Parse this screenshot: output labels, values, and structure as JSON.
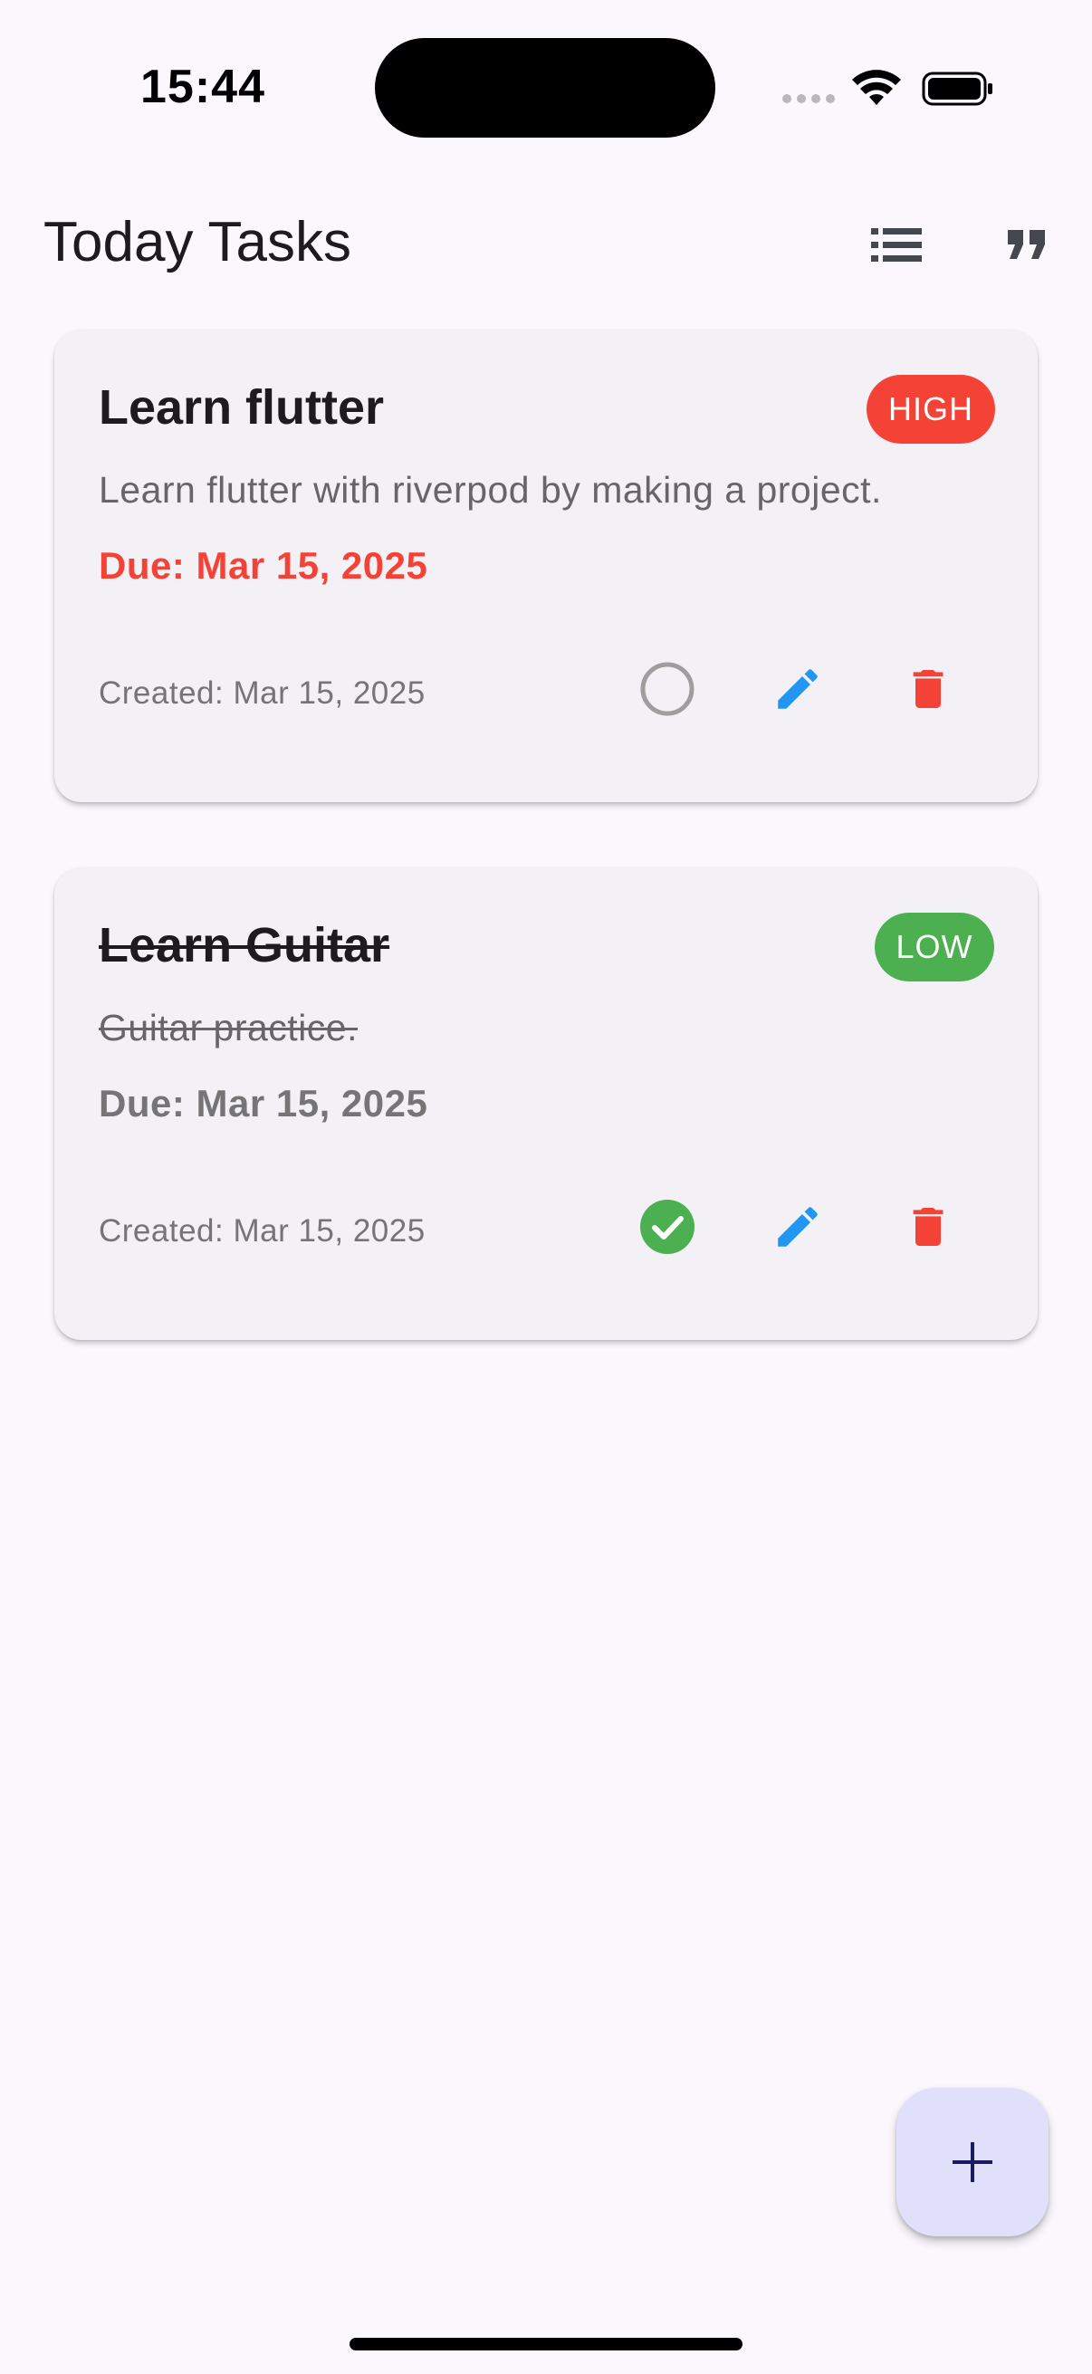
{
  "status_bar": {
    "time": "15:44"
  },
  "app_bar": {
    "title": "Today Tasks",
    "actions": [
      "list-icon",
      "format-quote-icon"
    ]
  },
  "tasks": [
    {
      "title": "Learn flutter",
      "priority": "HIGH",
      "priority_color": "#f44336",
      "description": "Learn flutter with riverpod by making a project.",
      "due": "Due: Mar 15, 2025",
      "created": "Created: Mar 15, 2025",
      "completed": false
    },
    {
      "title": "Learn Guitar",
      "priority": "LOW",
      "priority_color": "#4caf50",
      "description": "Guitar practice.",
      "due": "Due: Mar 15, 2025",
      "created": "Created: Mar 15, 2025",
      "completed": true
    }
  ],
  "colors": {
    "accent_edit": "#2196f3",
    "delete": "#f44336",
    "completed": "#4caf50",
    "fab_background": "#e0e0fb"
  },
  "fab": {
    "icon": "add-icon",
    "glyph": "+"
  }
}
